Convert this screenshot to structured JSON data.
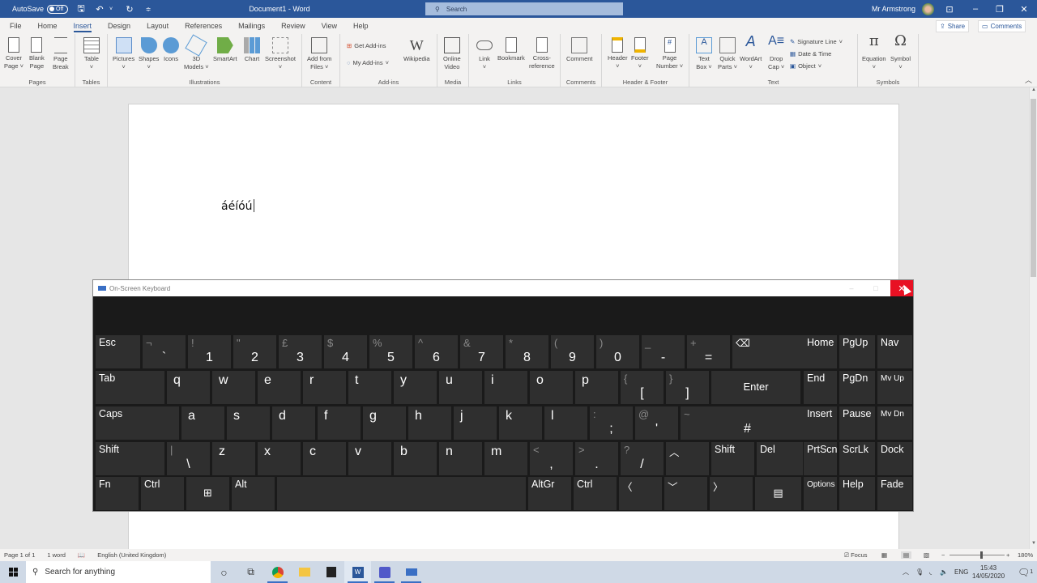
{
  "titlebar": {
    "autosave_label": "AutoSave",
    "autosave_state": "Off",
    "doc_title": "Document1  -  Word",
    "search_placeholder": "Search",
    "user_name": "Mr Armstrong"
  },
  "tabs": [
    "File",
    "Home",
    "Insert",
    "Design",
    "Layout",
    "References",
    "Mailings",
    "Review",
    "View",
    "Help"
  ],
  "active_tab": "Insert",
  "share_label": "Share",
  "comments_label": "Comments",
  "ribbon": {
    "groups": {
      "pages": "Pages",
      "tables": "Tables",
      "illustrations": "Illustrations",
      "content": "Content",
      "addins": "Add-ins",
      "media": "Media",
      "links": "Links",
      "comments": "Comments",
      "headerfooter": "Header & Footer",
      "text": "Text",
      "symbols": "Symbols"
    },
    "buttons": {
      "cover_page": "Cover\nPage ˅",
      "blank_page": "Blank\nPage",
      "page_break": "Page\nBreak",
      "table": "Table\n˅",
      "pictures": "Pictures\n˅",
      "shapes": "Shapes\n˅",
      "icons": "Icons",
      "models3d": "3D\nModels ˅",
      "smartart": "SmartArt",
      "chart": "Chart",
      "screenshot": "Screenshot\n˅",
      "add_from_files": "Add from\nFiles ˅",
      "get_addins": "Get Add-ins",
      "my_addins": "My Add-ins",
      "wikipedia": "Wikipedia",
      "online_video": "Online\nVideo",
      "link": "Link\n˅",
      "bookmark": "Bookmark",
      "cross_reference": "Cross-\nreference",
      "comment": "Comment",
      "header": "Header\n˅",
      "footer": "Footer\n˅",
      "page_number": "Page\nNumber ˅",
      "text_box": "Text\nBox ˅",
      "quick_parts": "Quick\nParts ˅",
      "wordart": "WordArt\n˅",
      "drop_cap": "Drop\nCap ˅",
      "signature_line": "Signature Line",
      "date_time": "Date & Time",
      "object": "Object",
      "equation": "Equation\n˅",
      "symbol": "Symbol\n˅"
    }
  },
  "document": {
    "text": "áéíóú"
  },
  "statusbar": {
    "page": "Page 1 of 1",
    "words": "1 word",
    "language": "English (United Kingdom)",
    "focus": "Focus",
    "zoom": "180%",
    "zoom_minus": "−",
    "zoom_plus": "+"
  },
  "taskbar": {
    "search_placeholder": "Search for anything",
    "time": "15:43",
    "date": "14/05/2020",
    "lang": "ENG",
    "notifications": "1"
  },
  "osk": {
    "title": "On-Screen Keyboard",
    "rows": [
      [
        {
          "id": "esc",
          "label": "Esc"
        },
        {
          "id": "backtick",
          "sec": "¬",
          "pri": "`"
        },
        {
          "id": "1",
          "sec": "!",
          "pri": "1"
        },
        {
          "id": "2",
          "sec": "\"",
          "pri": "2"
        },
        {
          "id": "3",
          "sec": "£",
          "pri": "3"
        },
        {
          "id": "4",
          "sec": "$",
          "pri": "4"
        },
        {
          "id": "5",
          "sec": "%",
          "pri": "5"
        },
        {
          "id": "6",
          "sec": "^",
          "pri": "6"
        },
        {
          "id": "7",
          "sec": "&",
          "pri": "7"
        },
        {
          "id": "8",
          "sec": "*",
          "pri": "8"
        },
        {
          "id": "9",
          "sec": "(",
          "pri": "9"
        },
        {
          "id": "0",
          "sec": ")",
          "pri": "0"
        },
        {
          "id": "minus",
          "sec": "_",
          "pri": "-"
        },
        {
          "id": "equals",
          "sec": "+",
          "pri": "="
        },
        {
          "id": "backspace",
          "label": "⌫"
        }
      ],
      [
        {
          "id": "tab",
          "label": "Tab"
        },
        {
          "id": "q",
          "let": "q"
        },
        {
          "id": "w",
          "let": "w"
        },
        {
          "id": "e",
          "let": "e"
        },
        {
          "id": "r",
          "let": "r"
        },
        {
          "id": "t",
          "let": "t"
        },
        {
          "id": "y",
          "let": "y"
        },
        {
          "id": "u",
          "let": "u"
        },
        {
          "id": "i",
          "let": "i"
        },
        {
          "id": "o",
          "let": "o"
        },
        {
          "id": "p",
          "let": "p"
        },
        {
          "id": "lbracket",
          "sec": "{",
          "pri": "["
        },
        {
          "id": "rbracket",
          "sec": "}",
          "pri": "]"
        },
        {
          "id": "enter",
          "mid": "Enter"
        }
      ],
      [
        {
          "id": "caps",
          "label": "Caps"
        },
        {
          "id": "a",
          "let": "a"
        },
        {
          "id": "s",
          "let": "s"
        },
        {
          "id": "d",
          "let": "d"
        },
        {
          "id": "f",
          "let": "f"
        },
        {
          "id": "g",
          "let": "g"
        },
        {
          "id": "h",
          "let": "h"
        },
        {
          "id": "j",
          "let": "j"
        },
        {
          "id": "k",
          "let": "k"
        },
        {
          "id": "l",
          "let": "l"
        },
        {
          "id": "semicolon",
          "sec": ":",
          "pri": ";"
        },
        {
          "id": "quote",
          "sec": "@",
          "pri": "'"
        },
        {
          "id": "hash",
          "sec": "~",
          "pri": "#"
        }
      ],
      [
        {
          "id": "lshift",
          "label": "Shift"
        },
        {
          "id": "backslash",
          "sec": "|",
          "pri": "\\"
        },
        {
          "id": "z",
          "let": "z"
        },
        {
          "id": "x",
          "let": "x"
        },
        {
          "id": "c",
          "let": "c"
        },
        {
          "id": "v",
          "let": "v"
        },
        {
          "id": "b",
          "let": "b"
        },
        {
          "id": "n",
          "let": "n"
        },
        {
          "id": "m",
          "let": "m"
        },
        {
          "id": "comma",
          "sec": "<",
          "pri": ","
        },
        {
          "id": "period",
          "sec": ">",
          "pri": "."
        },
        {
          "id": "slash",
          "sec": "?",
          "pri": "/"
        },
        {
          "id": "up",
          "label": "︿"
        },
        {
          "id": "rshift",
          "label": "Shift"
        },
        {
          "id": "del",
          "label": "Del"
        }
      ],
      [
        {
          "id": "fn",
          "label": "Fn"
        },
        {
          "id": "lctrl",
          "label": "Ctrl"
        },
        {
          "id": "win",
          "mid": "⊞"
        },
        {
          "id": "alt",
          "label": "Alt"
        },
        {
          "id": "space",
          "label": ""
        },
        {
          "id": "altgr",
          "label": "AltGr"
        },
        {
          "id": "rctrl",
          "label": "Ctrl"
        },
        {
          "id": "left",
          "label": "〈"
        },
        {
          "id": "down",
          "label": "﹀"
        },
        {
          "id": "right",
          "label": "〉"
        },
        {
          "id": "menu",
          "mid": "▤"
        }
      ]
    ],
    "side": [
      [
        "Home",
        "PgUp",
        "Nav"
      ],
      [
        "End",
        "PgDn",
        "Mv Up"
      ],
      [
        "Insert",
        "Pause",
        "Mv Dn"
      ],
      [
        "PrtScn",
        "ScrLk",
        "Dock"
      ],
      [
        "Options",
        "Help",
        "Fade"
      ]
    ]
  }
}
